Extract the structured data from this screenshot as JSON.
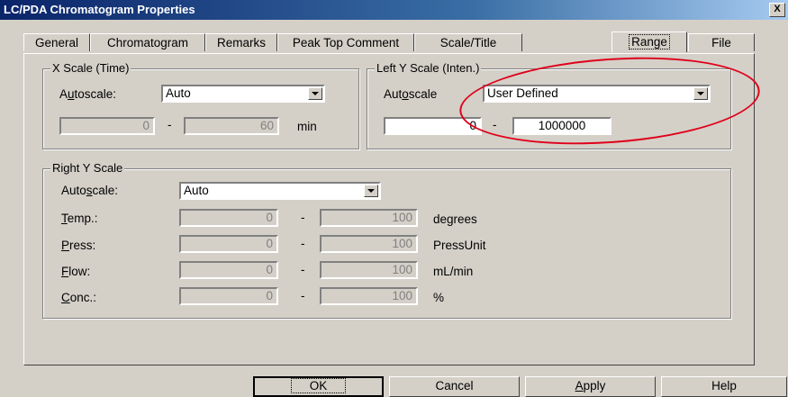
{
  "window": {
    "title": "LC/PDA Chromatogram Properties",
    "close_label": "X"
  },
  "tabs": [
    {
      "label": "General"
    },
    {
      "label": "Chromatogram"
    },
    {
      "label": "Remarks"
    },
    {
      "label": "Peak Top Comment"
    },
    {
      "label": "Scale/Title"
    },
    {
      "label": "Range",
      "active": true
    },
    {
      "label": "File"
    }
  ],
  "x_scale": {
    "group_title": "X Scale (Time)",
    "autoscale_label_pre": "A",
    "autoscale_label_u": "u",
    "autoscale_label_post": "toscale:",
    "autoscale_value": "Auto",
    "min_value": "0",
    "max_value": "60",
    "separator": "-",
    "unit": "min"
  },
  "left_y_scale": {
    "group_title": "Left Y Scale (Inten.)",
    "autoscale_label_pre": "Aut",
    "autoscale_label_u": "o",
    "autoscale_label_post": "scale",
    "autoscale_value": "User Defined",
    "min_value": "0",
    "max_value": "1000000",
    "separator": "-"
  },
  "right_y_scale": {
    "group_title": "Right Y Scale",
    "autoscale_label_pre": "Auto",
    "autoscale_label_u": "s",
    "autoscale_label_post": "cale:",
    "autoscale_value": "Auto",
    "separator": "-",
    "rows": [
      {
        "label_u": "T",
        "label_rest": "emp.:",
        "min": "0",
        "max": "100",
        "unit": "degrees"
      },
      {
        "label_u": "P",
        "label_rest": "ress:",
        "min": "0",
        "max": "100",
        "unit": "PressUnit"
      },
      {
        "label_u": "F",
        "label_rest": "low:",
        "min": "0",
        "max": "100",
        "unit": "mL/min"
      },
      {
        "label_u": "C",
        "label_rest": "onc.:",
        "min": "0",
        "max": "100",
        "unit": "%"
      }
    ]
  },
  "buttons": {
    "ok": "OK",
    "cancel": "Cancel",
    "apply_u": "A",
    "apply_rest": "pply",
    "help": "Help"
  },
  "annotation_color": "#e0001a"
}
